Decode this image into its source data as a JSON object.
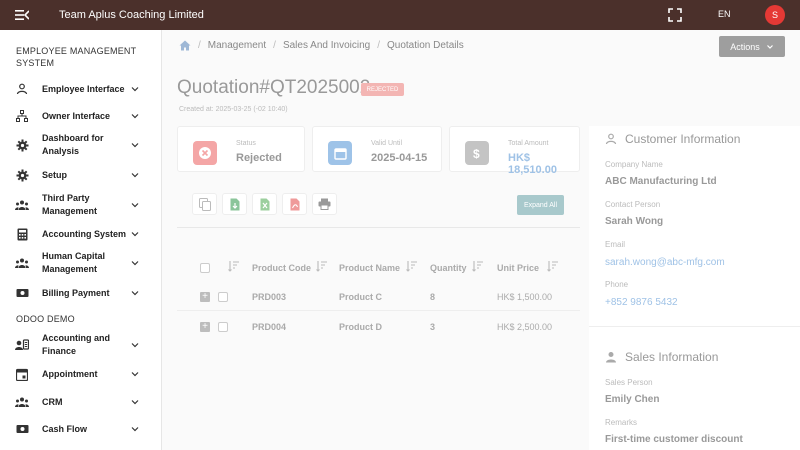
{
  "header": {
    "title": "Team Aplus Coaching Limited",
    "language": "EN",
    "avatar_initial": "S",
    "brand_color": "#4b302b",
    "avatar_color": "#e53935"
  },
  "sidebar": {
    "section1": "EMPLOYEE MANAGEMENT SYSTEM",
    "items": [
      {
        "label": "Employee Interface",
        "icon": "person-icon"
      },
      {
        "label": "Owner Interface",
        "icon": "org-chart-icon"
      },
      {
        "label": "Dashboard for Analysis",
        "icon": "gear-icon"
      },
      {
        "label": "Setup",
        "icon": "gear-icon"
      },
      {
        "label": "Third Party Management",
        "icon": "group-icon"
      },
      {
        "label": "Accounting System",
        "icon": "calculator-icon"
      },
      {
        "label": "Human Capital Management",
        "icon": "group-icon"
      },
      {
        "label": "Billing Payment",
        "icon": "money-icon"
      }
    ],
    "section2": "ODOO DEMO",
    "items2": [
      {
        "label": "Accounting and Finance",
        "icon": "contact-icon"
      },
      {
        "label": "Appointment",
        "icon": "calendar-icon"
      },
      {
        "label": "CRM",
        "icon": "group-icon"
      },
      {
        "label": "Cash Flow",
        "icon": "money-icon"
      }
    ]
  },
  "breadcrumb": {
    "items": [
      "Management",
      "Sales And Invoicing",
      "Quotation Details"
    ]
  },
  "actions_label": "Actions",
  "quotation": {
    "title": "Quotation#QT2025002",
    "badge": "REJECTED",
    "meta": "Created at: 2025-03-25 (-02 10:40)"
  },
  "stats": [
    {
      "label": "Status",
      "value": "Rejected",
      "color": "#f4a6a6"
    },
    {
      "label": "Valid Until",
      "value": "2025-04-15",
      "color": "#9ec3e8"
    },
    {
      "label": "Total Amount",
      "value": "HK$ 18,510.00",
      "color": "#c4c4c4"
    }
  ],
  "expand_all": "Expand All",
  "table": {
    "headers": [
      "Product Code",
      "Product Name",
      "Quantity",
      "Unit Price"
    ],
    "rows": [
      {
        "code": "PRD003",
        "name": "Product C",
        "qty": "8",
        "price": "HK$ 1,500.00"
      },
      {
        "code": "PRD004",
        "name": "Product D",
        "qty": "3",
        "price": "HK$ 2,500.00"
      }
    ]
  },
  "customer": {
    "heading": "Customer Information",
    "company_label": "Company Name",
    "company": "ABC Manufacturing Ltd",
    "contact_label": "Contact Person",
    "contact": "Sarah Wong",
    "email_label": "Email",
    "email": "sarah.wong@abc-mfg.com",
    "phone_label": "Phone",
    "phone": "+852 9876 5432"
  },
  "sales": {
    "heading": "Sales Information",
    "person_label": "Sales Person",
    "person": "Emily Chen",
    "remarks_label": "Remarks",
    "remarks": "First-time customer discount"
  }
}
